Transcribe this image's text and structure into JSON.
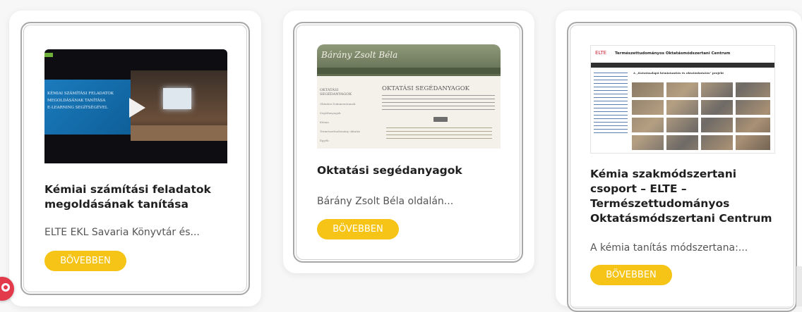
{
  "cards": [
    {
      "title_line1": "Kémiai számítási feladatok",
      "title_line2": "megoldásának tanítása",
      "excerpt": "ELTE EKL Savaria Könyvtár és...",
      "button": "BÖVEBBEN",
      "thumb_overlay_lines": [
        "KÉMIAI SZÁMÍTÁSI FELADATOK",
        "MEGOLDÁSÁNAK TANÍTÁSA",
        "E-LEARNING SEGÍTSÉGÉVEL"
      ],
      "thumb_icon": "play-icon"
    },
    {
      "title": "Oktatási segédanyagok",
      "excerpt": "Bárány Zsolt Béla oldalán...",
      "button": "BÖVEBBEN",
      "thumb_site_name": "Bárány Zsolt Béla",
      "thumb_heading": "OKTATÁSI SEGÉDANYAGOK",
      "thumb_sidebar_title": "OKTATÁSI SEGÉDANYAGOK",
      "thumb_sidebar_items": [
        "Oktatási Dokumentumok",
        "Segédanyagok",
        "Kémia",
        "Természettudomány oktatás",
        "Egyéb"
      ]
    },
    {
      "title_line1": "Kémia szakmódszertani",
      "title_line2": "csoport – ELTE –",
      "title_line3": "Természettudományos",
      "title_line4": "Oktatásmódszertani Centrum",
      "excerpt": "A kémia tanítás módszertana:...",
      "button": "BÖVEBBEN",
      "thumb_logo": "ELTE",
      "thumb_site_title": "Természettudományos Oktatásmódszertani Centrum",
      "thumb_heading": "A „Kutatásalapú kémiatanítás és oktatáskutatás” projekt"
    }
  ],
  "colors": {
    "button_bg": "#f5c416",
    "accent_red": "#e23a4a"
  },
  "floating_icon": "help-icon"
}
